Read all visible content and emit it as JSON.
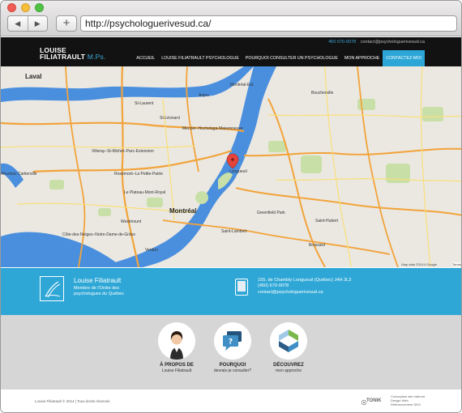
{
  "browser": {
    "url": "http://psychologuerivesud.ca/",
    "back_glyph": "◀",
    "forward_glyph": "▶",
    "new_tab_glyph": "+"
  },
  "header": {
    "brand_line1": "LOUISE",
    "brand_line2": "FILIATRAULT",
    "brand_suffix": "M.Ps.",
    "phone": "450 670-0078",
    "email": "contact@psychologuerivesud.ca",
    "nav": [
      {
        "label": "ACCUEIL"
      },
      {
        "label": "LOUISE FILIATRAULT PSYCHOLOGUE"
      },
      {
        "label": "POURQUOI CONSULTER UN PSYCHOLOGUE"
      },
      {
        "label": "MON APPROCHE"
      },
      {
        "label": "CONTACTEZ-MOI"
      }
    ]
  },
  "map": {
    "labels": {
      "laval": "Laval",
      "montreal": "Montréal",
      "longueuil": "Longueuil",
      "boucherville": "Boucherville",
      "saint_laurent": "St-Laurent",
      "mercier": "Mercier–Hochelaga-Maisonneuve",
      "villeray": "Villeray–St-Michel–Parc-Extension",
      "ahuntsic": "Ahuntsic-Cartierville",
      "rosemont": "Rosemont–La Petite-Patrie",
      "plateau": "Le Plateau-Mont-Royal",
      "cdn": "Côte-des-Neiges–Notre-Dame-de-Grâce",
      "saint_hubert": "Saint-Hubert",
      "greenfield": "Greenfield Park",
      "brossard": "Brossard",
      "montreal_est": "Montréal-Est",
      "anjou": "Anjou",
      "saint_leonard": "St-Léonard",
      "saint_lambert": "Saint-Lambert",
      "westmount": "Westmount",
      "verdun": "Verdun"
    },
    "credit": "Map data ©2014 Google",
    "terms": "Terms"
  },
  "info": {
    "name": "Louise Filiatrault",
    "subtitle": "Membre de l'Ordre des psychologues du Québec",
    "address": "155, de Chambly Longueuil (Québec) J4H 3L3",
    "phone": "(450) 670-0078",
    "email": "contact@psychologuerivesud.ca"
  },
  "features": [
    {
      "title": "À PROPOS DE",
      "subtitle": "Louise Filiatrault",
      "icon": "woman-avatar-icon"
    },
    {
      "title": "POURQUOI",
      "subtitle": "devrais-je consulter?",
      "icon": "speech-bubble-question-icon"
    },
    {
      "title": "DÉCOUVREZ",
      "subtitle": "mon approche",
      "icon": "approach-logo-icon"
    }
  ],
  "footer": {
    "copyright": "Louise Filiatrault © 2014 | Tous droits réservés",
    "agency_name": "TONIK",
    "agency_tagline": "",
    "credits": [
      "Conception site internet",
      "Design Web",
      "Référencement SEO"
    ]
  },
  "colors": {
    "accent": "#2ea7d6",
    "header_bg": "#121212",
    "gray_band": "#d6d6d6",
    "water": "#4a8fde",
    "pin": "#e5443b"
  }
}
